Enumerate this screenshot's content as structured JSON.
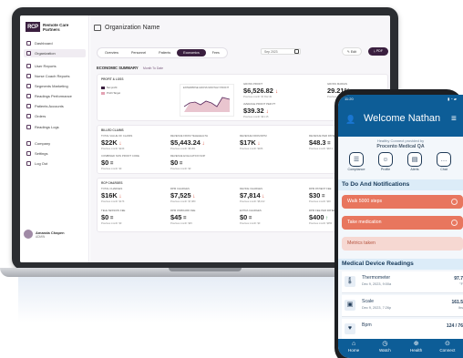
{
  "web": {
    "logo_mark": "RCP",
    "logo_line1": "Remote Care",
    "logo_line2": "Partners",
    "sidebar": [
      {
        "label": "Dashboard",
        "icon": "dashboard-icon"
      },
      {
        "label": "Organization",
        "icon": "building-icon"
      },
      {
        "label": "User Reports",
        "icon": "user-report-icon"
      },
      {
        "label": "Nurse Coach Reports",
        "icon": "nurse-icon"
      },
      {
        "label": "Segments Marketing",
        "icon": "segments-icon"
      },
      {
        "label": "Readings Performance",
        "icon": "readings-icon"
      },
      {
        "label": "Patients Accounts",
        "icon": "patients-icon"
      },
      {
        "label": "Orders",
        "icon": "cart-icon"
      },
      {
        "label": "Readings Logs",
        "icon": "download-icon"
      },
      {
        "label": "Company",
        "icon": "company-icon"
      },
      {
        "label": "Settings",
        "icon": "gear-icon"
      },
      {
        "label": "Log Out",
        "icon": "logout-icon"
      }
    ],
    "user_name": "Amanda Chapen",
    "user_role": "ADMIN",
    "page_title": "Organization Name",
    "tabs": [
      "Overview",
      "Personnel",
      "Patients",
      "Economics",
      "Fees"
    ],
    "active_tab": "Economics",
    "date_value": "Sep 2023",
    "edit_label": "Edit",
    "pdf_label": "PDF",
    "summary_title": "ECONOMIC SUMMARY",
    "summary_link": "Month To Date",
    "sections": {
      "profit": {
        "title": "PROFIT & LOSS",
        "chart_label": "Enterprise Gross Monthly Profit",
        "legend": [
          "Net profit",
          "Profit Target"
        ],
        "kpis": [
          {
            "label": "GROSS PROFIT",
            "value": "$6,526.82",
            "trend": "down",
            "sub": "Previous month: $7,812.49"
          },
          {
            "label": "GROSS MARGIN",
            "value": "29.21%",
            "trend": "down",
            "sub": "Previous month: 31.4%"
          },
          {
            "label": "AVERAGE PROFIT PER PT",
            "value": "$39.32",
            "trend": "down",
            "sub": "Previous month: $41.15"
          }
        ]
      },
      "billed": {
        "title": "BILLED CLAIMS",
        "kpis": [
          {
            "label": "TOTAL VALUE OF CLAIMS",
            "value": "$22K",
            "trend": "down",
            "sub": "Previous month: $24K"
          },
          {
            "label": "REVENUE FROM TELEHEALTH",
            "value": "$5,443.24",
            "trend": "down",
            "sub": "Previous month: $5,901"
          },
          {
            "label": "REVENUE FROM RPM",
            "value": "$17K",
            "trend": "down",
            "sub": "Previous month: $18K"
          },
          {
            "label": "REVENUE PER PATIENT",
            "value": "$48.3",
            "trend": "eq",
            "sub": "Previous month: $48.3"
          },
          {
            "label": "COMBINED NON PROFIT CODE",
            "value": "$0",
            "trend": "eq",
            "sub": "Previous month: $0"
          },
          {
            "label": "REVENUE EVALUATION SOP",
            "value": "$0",
            "trend": "eq",
            "sub": "Previous month: $0"
          }
        ]
      },
      "rcp": {
        "title": "RCP CHARGES",
        "kpis": [
          {
            "label": "TOTAL CHARGES",
            "value": "$16K",
            "trend": "down",
            "sub": "Previous month: $17K"
          },
          {
            "label": "RPM CHARGES",
            "value": "$7,525",
            "trend": "down",
            "sub": "Previous month: $7,980"
          },
          {
            "label": "DEVICE CHARGES",
            "value": "$7,814",
            "trend": "down",
            "sub": "Previous month: $8,102"
          },
          {
            "label": "RPM PATIENT FEE",
            "value": "$30",
            "trend": "eq",
            "sub": "Previous month: $30"
          },
          {
            "label": "TELE SESSION FEE",
            "value": "$0",
            "trend": "eq",
            "sub": "Previous month: $0"
          },
          {
            "label": "RPM ONBOARD FEE",
            "value": "$45",
            "trend": "eq",
            "sub": "Previous month: $45"
          },
          {
            "label": "EXTRA CHARGES",
            "value": "$0",
            "trend": "eq",
            "sub": "Previous month: $0"
          },
          {
            "label": "RPM FEE PER PATIENT",
            "value": "$400",
            "trend": "up",
            "sub": "Previous month: $350"
          }
        ]
      }
    }
  },
  "mobile": {
    "status_time": "11:20",
    "status_icons": "▮ ◔ ▰",
    "title": "Welcome Nathan",
    "provided_by": "Healthy Connect provided by",
    "org": "Procento Medical QA",
    "quick": [
      {
        "label": "Compliance",
        "icon": "clipboard-icon",
        "glyph": "☰"
      },
      {
        "label": "Profile",
        "icon": "profile-icon",
        "glyph": "☺"
      },
      {
        "label": "Alerts",
        "icon": "alert-icon",
        "glyph": "▤"
      },
      {
        "label": "Chat",
        "icon": "chat-icon",
        "glyph": "…"
      }
    ],
    "todo_title": "To Do And Notifications",
    "todos": [
      {
        "label": "Walk 5000 steps",
        "color": "#e8765e"
      },
      {
        "label": "Take medication",
        "color": "#e8765e"
      },
      {
        "label": "Metrics taken",
        "color": "#f6d8d2"
      }
    ],
    "readings_title": "Medical Device Readings",
    "readings": [
      {
        "name": "Thermometer",
        "date": "Dec 9, 2023, 9:00a",
        "value": "97.7",
        "unit": "°F",
        "glyph": "🌡"
      },
      {
        "name": "Scale",
        "date": "Dec 9, 2023, 7:26p",
        "value": "161.5",
        "unit": "lbs",
        "glyph": "▣"
      },
      {
        "name": "Bpm",
        "date": "",
        "value": "124 / 76",
        "unit": "",
        "glyph": "♥"
      }
    ],
    "nav": [
      {
        "label": "Home",
        "icon": "home-icon",
        "glyph": "⌂"
      },
      {
        "label": "Watch",
        "icon": "watch-icon",
        "glyph": "◷"
      },
      {
        "label": "Health",
        "icon": "health-icon",
        "glyph": "⊕"
      },
      {
        "label": "Connect",
        "icon": "connect-icon",
        "glyph": "⊙"
      }
    ]
  },
  "colors": {
    "brand_purple": "#3a1f3f",
    "phone_blue": "#0d5d97",
    "todo_coral": "#e8765e",
    "down": "#d8442f",
    "up": "#2e9b4f"
  }
}
